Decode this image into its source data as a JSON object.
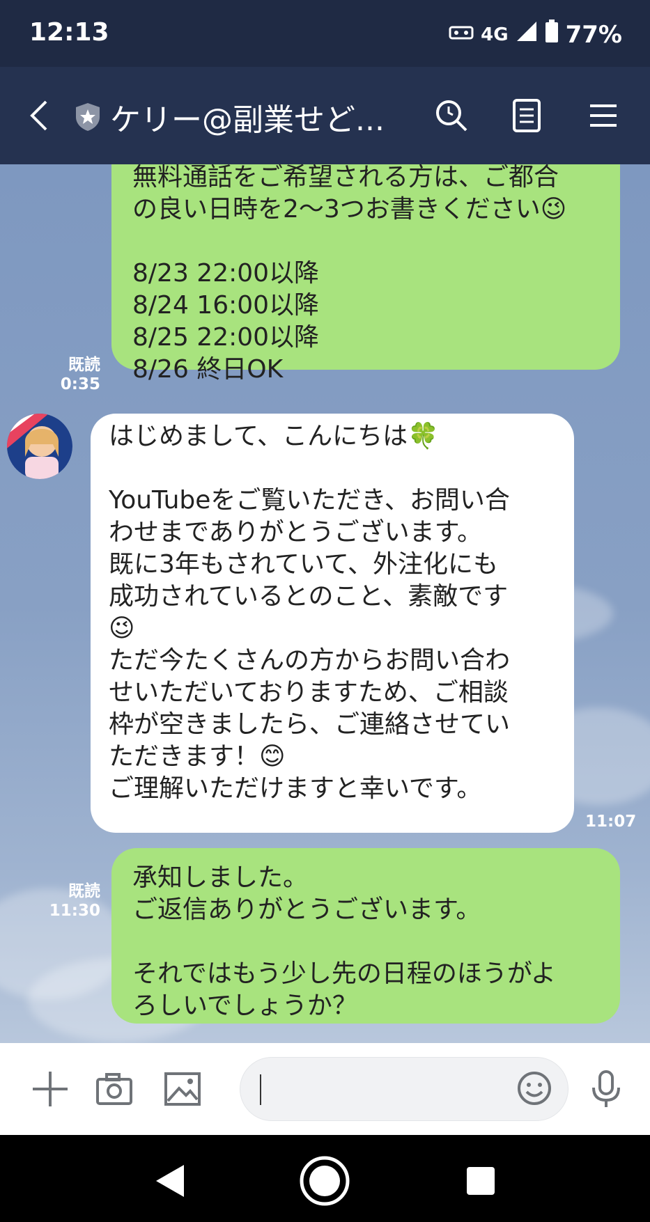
{
  "status_bar": {
    "time": "12:13",
    "network": "4G",
    "battery": "77%"
  },
  "header": {
    "title": "ケリー@副業せど..."
  },
  "messages": [
    {
      "side": "right",
      "text": "無料通話をご希望される方は、ご都合\nの良い日時を2～3つお書きください😉\n\n8/23  22:00以降\n8/24  16:00以降\n8/25  22:00以降\n8/26  終日OK",
      "read_label": "既読",
      "time": "0:35"
    },
    {
      "side": "left",
      "text": "はじめまして、こんにちは🍀\n\nYouTubeをご覧いただき、お問い合\nわせまでありがとうございます。\n既に3年もされていて、外注化にも\n成功されているとのこと、素敵です\n😉\nただ今たくさんの方からお問い合わ\nせいただいておりますため、ご相談\n枠が空きましたら、ご連絡させてい\nただきます！😊\nご理解いただけますと幸いです。",
      "time": "11:07"
    },
    {
      "side": "right",
      "text": "承知しました。\nご返信ありがとうございます。\n\nそれではもう少し先の日程のほうがよ\nろしいでしょうか？",
      "read_label": "既読",
      "time": "11:30"
    }
  ],
  "input": {
    "placeholder": ""
  },
  "icons": {
    "back": "back-icon",
    "shield": "shield-star-icon",
    "search": "search-icon",
    "notes": "notes-icon",
    "menu": "menu-icon",
    "plus": "plus-icon",
    "camera": "camera-icon",
    "image": "image-icon",
    "emoji": "emoji-icon",
    "mic": "mic-icon",
    "nav_back": "nav-back-icon",
    "nav_home": "nav-home-icon",
    "nav_recent": "nav-recent-icon"
  },
  "colors": {
    "header": "#253250",
    "status": "#1f2a44",
    "green_bubble": "#a8e37e",
    "chat_bg": "#7e98c0"
  }
}
